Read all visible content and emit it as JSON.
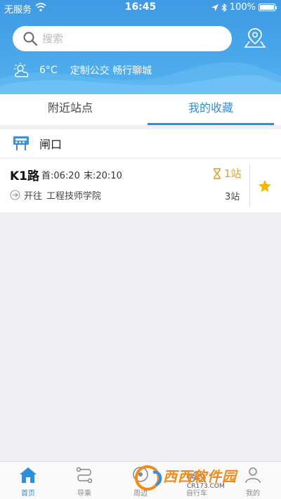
{
  "statusbar": {
    "carrier": "无服务",
    "time": "16:45",
    "battery": "100%",
    "battery_level": 1.0
  },
  "search": {
    "placeholder": "搜索"
  },
  "weather": {
    "temperature": "6°C",
    "slogan": "定制公交 畅行聊城",
    "icon": "partly-cloudy-icon"
  },
  "tabs": [
    {
      "label": "附近站点",
      "active": false
    },
    {
      "label": "我的收藏",
      "active": true
    }
  ],
  "station": {
    "name": "闸口",
    "icon": "bus-stop-icon"
  },
  "route": {
    "name": "K1路",
    "first": "首:06:20",
    "last": "末:20:10",
    "arrival": "1站",
    "direction_label": "开往",
    "destination": "工程技师学院",
    "stops": "3站",
    "favorited": true
  },
  "colors": {
    "accent": "#2f8ed8",
    "header": "#4aa7ea",
    "arrival": "#e39b2a",
    "star": "#f4b400"
  },
  "bottom_nav": [
    {
      "label": "首页",
      "icon": "home-icon",
      "active": true
    },
    {
      "label": "导乘",
      "icon": "route-icon",
      "active": false
    },
    {
      "label": "周边",
      "icon": "nearby-icon",
      "active": false
    },
    {
      "label": "自行车",
      "icon": "bicycle-icon",
      "active": false
    },
    {
      "label": "我的",
      "icon": "user-icon",
      "active": false
    }
  ],
  "watermark": {
    "text": "西西软件园",
    "sub": "CR173.COM"
  }
}
